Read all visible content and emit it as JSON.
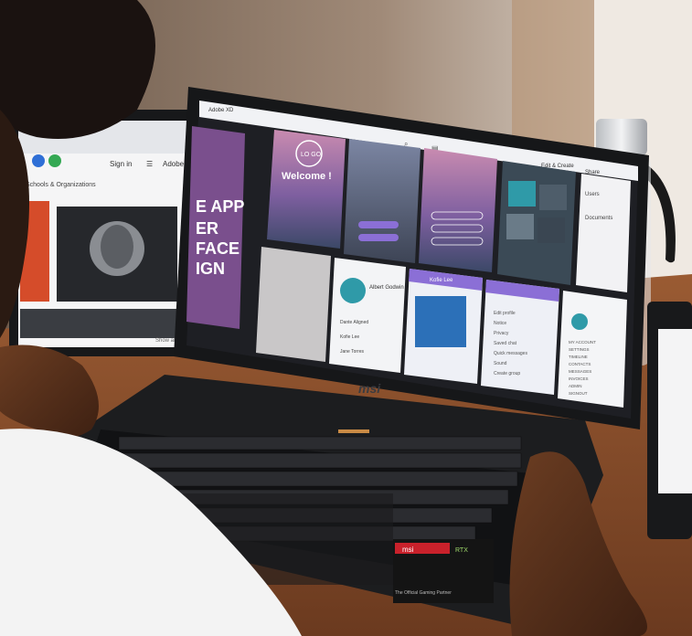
{
  "left_screen": {
    "toolbar": {
      "sign_in": "Sign in",
      "adobe": "Adobe"
    },
    "section_title": "Schools & Organizations",
    "poster_lines": [
      "E APP",
      "ER",
      "FACE",
      "IGN"
    ],
    "footer_label": "Show all"
  },
  "laptop": {
    "brand": "msi",
    "topbar": {
      "app_name": "Adobe XD",
      "share_label": "Share",
      "mode_label": "Edit & Create"
    },
    "artboards": {
      "welcome_title": "Welcome !",
      "logo_text": "LO GO",
      "contact_name_1": "Albert Godwin",
      "contact_name_2": "Kofie Lee",
      "list_names": [
        "Dante Aligned",
        "Kofie Lee",
        "Jane Torres"
      ],
      "menu_items": [
        "Edit profile",
        "Notice",
        "Privacy",
        "Saved chat",
        "Quick messages",
        "Sound",
        "Create group"
      ],
      "side_list": [
        "MY ACCOUNT",
        "SETTINGS",
        "TIMELINE",
        "CONTACTS",
        "MESSAGES",
        "INVOICES",
        "ADMIN",
        "SIGNOUT"
      ],
      "right_strip": [
        "Users",
        "Documents"
      ]
    },
    "stickers": [
      "msi",
      "RTX",
      "The Official Gaming Partner"
    ]
  },
  "colors": {
    "table": "#8a4f2a",
    "laptop": "#1b1c1e",
    "screen_bg": "#1e1f24",
    "accent_purple": "#8b6fd6",
    "sticker_red": "#c9212b"
  }
}
